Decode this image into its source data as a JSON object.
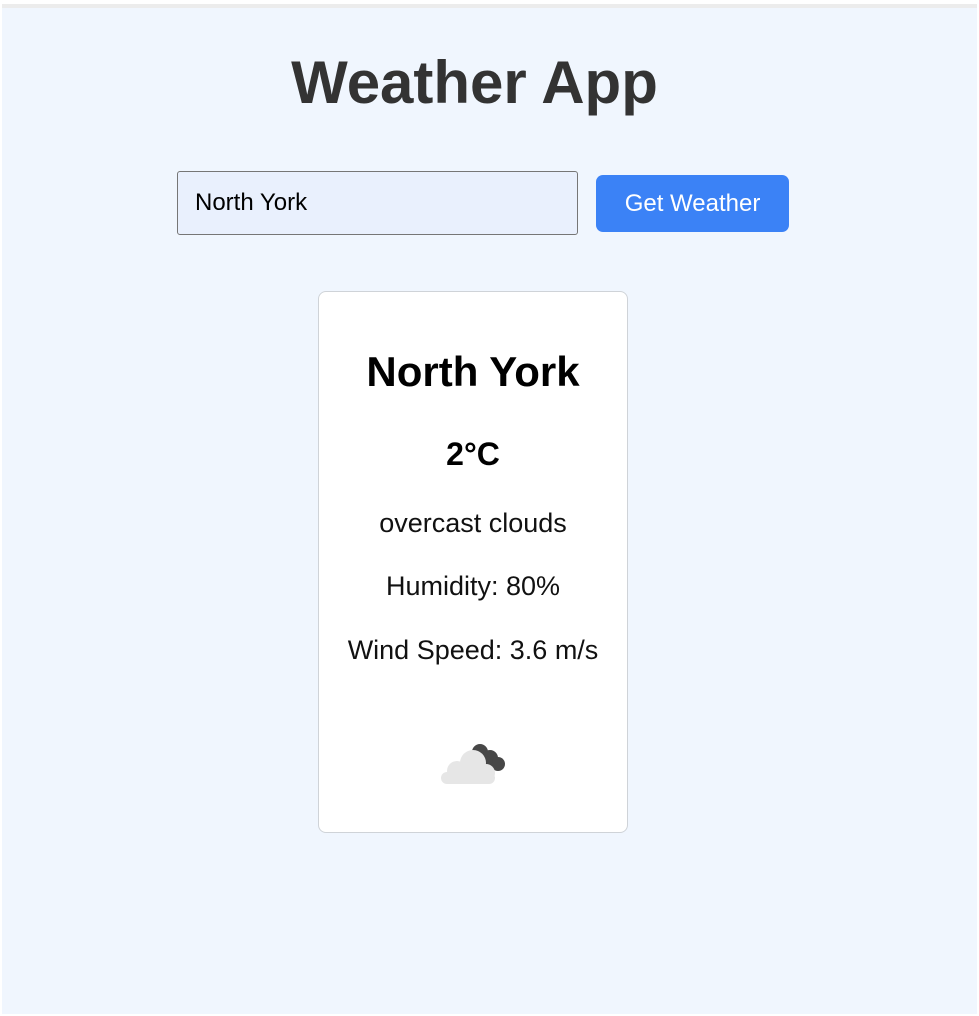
{
  "app": {
    "title": "Weather App"
  },
  "search": {
    "value": "North York",
    "button_label": "Get Weather"
  },
  "weather": {
    "city": "North York",
    "temperature": "2°C",
    "description": "overcast clouds",
    "humidity": "Humidity: 80%",
    "wind": "Wind Speed: 3.6 m/s",
    "icon": "overcast-clouds-icon"
  },
  "colors": {
    "background": "#f0f6fe",
    "button": "#3b82f6",
    "input_bg": "#e9f0fd",
    "title": "#333333"
  }
}
